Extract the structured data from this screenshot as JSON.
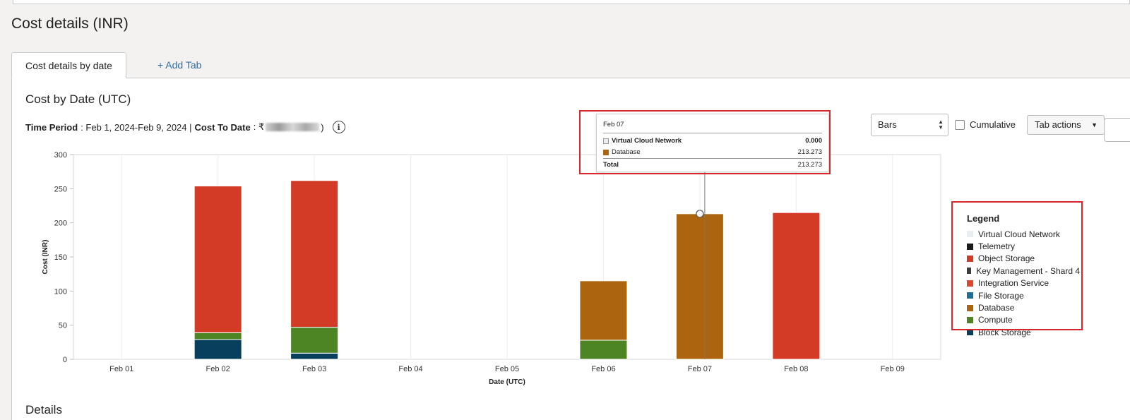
{
  "page": {
    "title": "Cost details (INR)"
  },
  "tabs": [
    {
      "label": "Cost details by date",
      "active": true
    },
    {
      "label": "+ Add Tab",
      "active": false
    }
  ],
  "section": {
    "title": "Cost by Date (UTC)",
    "period_label": "Time Period",
    "period_value": ": Feb 1, 2024-Feb 9, 2024 |",
    "cost_label": "Cost To Date",
    "cost_prefix": ": ₹",
    "cost_suffix": ")"
  },
  "controls": {
    "chart_type_value": "Bars",
    "cumulative_label": "Cumulative",
    "cumulative_checked": false,
    "tab_actions_label": "Tab actions"
  },
  "tooltip": {
    "date": "Feb 07",
    "rows": [
      {
        "name": "Virtual Cloud Network",
        "value": "0.000",
        "color": "#e8eef2"
      },
      {
        "name": "Database",
        "value": "213.273",
        "color": "#ad640e"
      }
    ],
    "total_label": "Total",
    "total_value": "213.273"
  },
  "legend": {
    "title": "Legend",
    "items": [
      {
        "name": "Virtual Cloud Network",
        "color": "#e8eef2"
      },
      {
        "name": "Telemetry",
        "color": "#1b1b1b"
      },
      {
        "name": "Object Storage",
        "color": "#d33b26"
      },
      {
        "name": "Key Management - Shard 4",
        "color": "#3c3c3c"
      },
      {
        "name": "Integration Service",
        "color": "#e0452d"
      },
      {
        "name": "File Storage",
        "color": "#1d6f96"
      },
      {
        "name": "Database",
        "color": "#ad640e"
      },
      {
        "name": "Compute",
        "color": "#4d8525"
      },
      {
        "name": "Block Storage",
        "color": "#083f5c"
      }
    ]
  },
  "details": {
    "title": "Details"
  },
  "chart_data": {
    "type": "bar",
    "stacked": true,
    "categories": [
      "Feb 01",
      "Feb 02",
      "Feb 03",
      "Feb 04",
      "Feb 05",
      "Feb 06",
      "Feb 07",
      "Feb 08",
      "Feb 09"
    ],
    "series": [
      {
        "name": "Block Storage",
        "color": "#083f5c",
        "values": [
          0,
          29,
          9,
          0,
          0,
          0,
          0,
          0,
          0
        ]
      },
      {
        "name": "Compute",
        "color": "#4d8525",
        "values": [
          0,
          10,
          38,
          0,
          0,
          28,
          0,
          0,
          0
        ]
      },
      {
        "name": "Database",
        "color": "#ad640e",
        "values": [
          0,
          0,
          0,
          0,
          0,
          87,
          213.273,
          0,
          0
        ]
      },
      {
        "name": "Object Storage",
        "color": "#d33b26",
        "values": [
          0,
          215,
          215,
          0,
          0,
          0,
          0,
          215,
          0
        ]
      }
    ],
    "xlabel": "Date (UTC)",
    "ylabel": "Cost (INR)",
    "ylim": [
      0,
      300
    ],
    "yticks": [
      0,
      50,
      100,
      150,
      200,
      250,
      300
    ],
    "grid": true,
    "legend_position": "right",
    "hover_category": "Feb 07"
  }
}
